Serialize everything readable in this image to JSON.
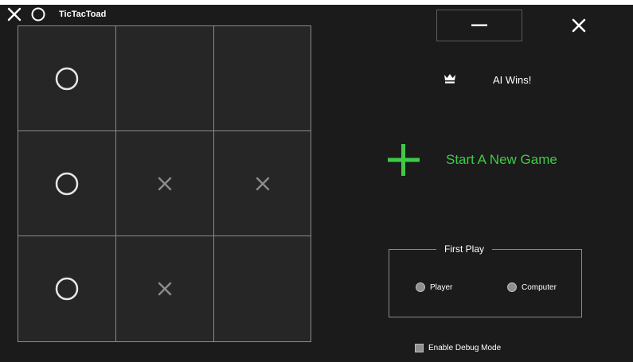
{
  "app": {
    "title": "TicTacToad"
  },
  "board": {
    "cells": [
      [
        "O",
        "",
        ""
      ],
      [
        "O",
        "X",
        "X"
      ],
      [
        "O",
        "X",
        ""
      ]
    ]
  },
  "status": {
    "text": "AI Wins!"
  },
  "new_game": {
    "label": "Start A New Game"
  },
  "first_play": {
    "legend": "First Play",
    "options": [
      "Player",
      "Computer"
    ]
  },
  "debug": {
    "label": "Enable Debug Mode"
  },
  "colors": {
    "background": "#1b1b1b",
    "cell": "#262626",
    "grid_line": "#8a8a8a",
    "accent_green": "#3dcb47",
    "o_mark": "#e6e6e6",
    "x_mark": "#8c8c8c"
  },
  "icons": [
    "app-x-icon",
    "app-o-icon",
    "minimize-icon",
    "close-icon",
    "crown-icon",
    "plus-icon"
  ]
}
